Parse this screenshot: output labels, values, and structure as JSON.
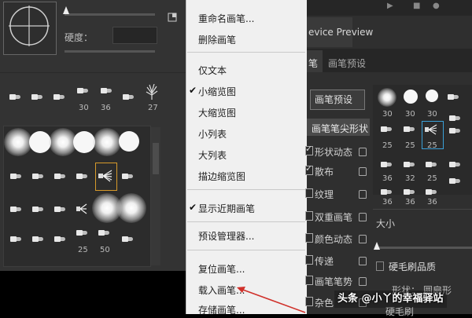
{
  "left_panel": {
    "hardness_label": "硬度：",
    "recent_sizes": [
      "30",
      "36",
      "27"
    ],
    "grid_sizes": [
      "25",
      "50"
    ]
  },
  "context_menu": {
    "items": [
      {
        "label": "重命名画笔...",
        "checked": false
      },
      {
        "label": "删除画笔",
        "checked": false
      },
      {
        "label": "仅文本",
        "checked": false
      },
      {
        "label": "小缩览图",
        "checked": true
      },
      {
        "label": "大缩览图",
        "checked": false
      },
      {
        "label": "小列表",
        "checked": false
      },
      {
        "label": "大列表",
        "checked": false
      },
      {
        "label": "描边缩览图",
        "checked": false
      },
      {
        "label": "显示近期画笔",
        "checked": true
      },
      {
        "label": "预设管理器...",
        "checked": false
      },
      {
        "label": "复位画笔...",
        "checked": false
      },
      {
        "label": "载入画笔...",
        "checked": false
      },
      {
        "label": "存储画笔...",
        "checked": false
      }
    ]
  },
  "right_panel": {
    "device_preview_tab": "evice Preview",
    "tabs": [
      "笔",
      "画笔预设"
    ],
    "preset_button": "画笔预设",
    "tip_shape_button": "画笔笔尖形状",
    "options": [
      "形状动态",
      "散布",
      "纹理",
      "双重画笔",
      "颜色动态",
      "传递",
      "画笔笔势",
      "杂色"
    ],
    "checked_options": [
      true,
      true,
      false,
      false,
      false,
      false,
      false,
      false
    ],
    "brush_sizes_row1": [
      "30",
      "30",
      "30"
    ],
    "brush_sizes_row2": [
      "25",
      "25",
      "25"
    ],
    "brush_sizes_row3": [
      "36",
      "32",
      "25"
    ],
    "brush_sizes_row4": [
      "36",
      "36",
      "36"
    ],
    "size_label": "大小",
    "quality_label": "硬毛刷品质",
    "shape_label": "形状：",
    "shape_value": "圆扇形",
    "bristles_label": "硬毛刷"
  },
  "watermark": "头条 @小丫的幸福驿站",
  "accent_colors": {
    "selection": "#d79a2b",
    "selection_right": "#3aa0d8",
    "arrow": "#d0302a"
  }
}
